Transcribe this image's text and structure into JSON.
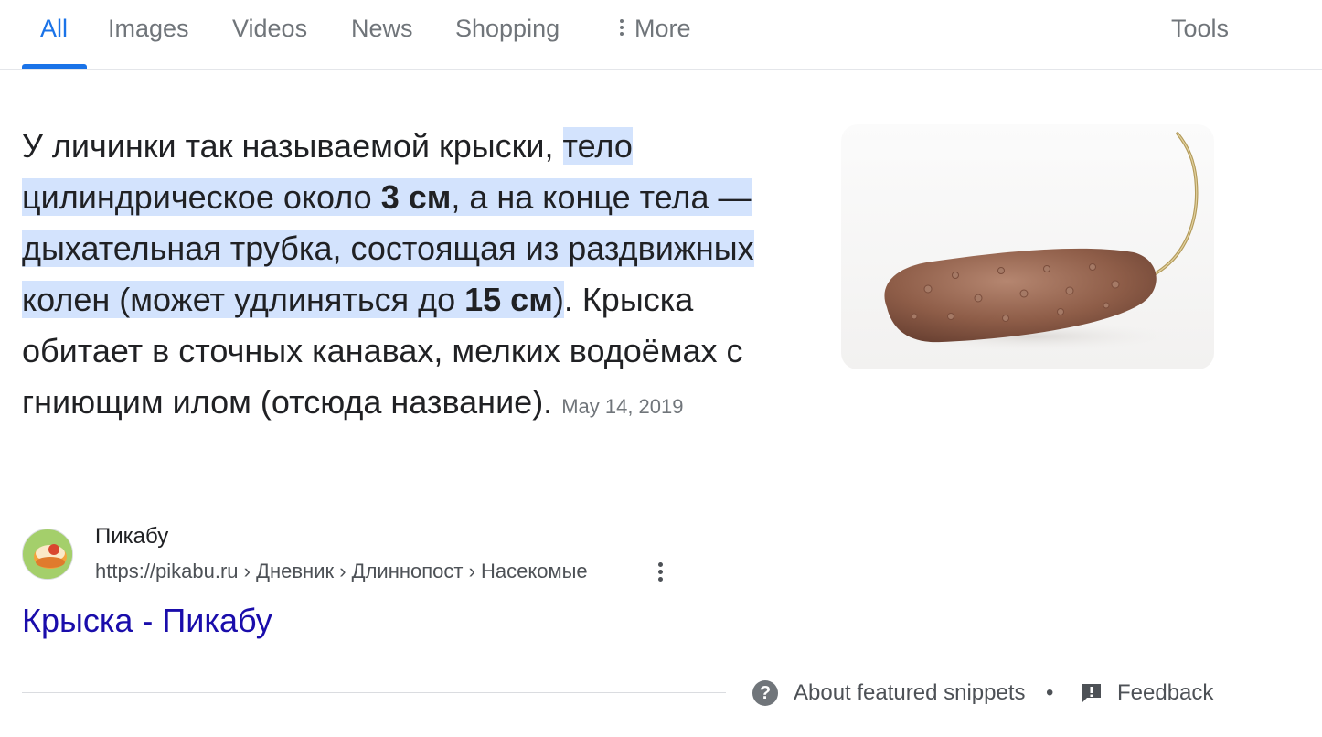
{
  "tabs": {
    "all": "All",
    "images": "Images",
    "videos": "Videos",
    "news": "News",
    "shopping": "Shopping",
    "more": "More",
    "tools": "Tools"
  },
  "snippet": {
    "text_lead": "У личинки так называемой крыски, ",
    "hl_part1": "тело цилиндрическое около ",
    "hl_bold1": "3 см",
    "hl_part2": ", а на конце тела — дыхательная трубка, состоящая из раздвижных колен (может удлиняться до ",
    "hl_bold2": "15 см",
    "hl_part3": ")",
    "text_tail": ". Крыска обитает в сточных канавах, мелких водоёмах с гниющим илом (отсюда название).",
    "date": "May 14, 2019"
  },
  "source": {
    "site_name": "Пикабу",
    "url": "https://pikabu.ru › Дневник › Длиннопост › Насекомые",
    "title": "Крыска - Пикабу"
  },
  "footer": {
    "help_glyph": "?",
    "about": "About featured snippets",
    "separator": "•",
    "feedback": "Feedback"
  },
  "colors": {
    "accent": "#1a73e8",
    "link": "#1a0dab",
    "highlight": "#d3e3fd",
    "muted": "#70757a"
  },
  "icons": [
    "more-vert-icon",
    "help-icon",
    "feedback-icon",
    "pikabu-favicon"
  ]
}
